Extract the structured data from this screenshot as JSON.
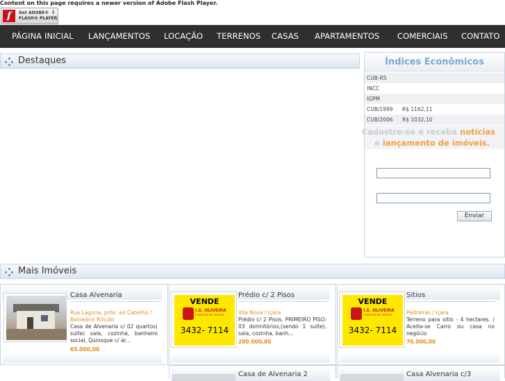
{
  "flash": {
    "message": "Content on this page requires a newer version of Adobe Flash Player.",
    "badge_line1": "Get ADOBE®",
    "badge_line2": "FLASH® PLAYER"
  },
  "nav": {
    "items": [
      "PÁGINA INICIAL",
      "LANÇAMENTOS",
      "LOCAÇÃO",
      "TERRENOS",
      "CASAS",
      "APARTAMENTOS",
      "COMERCIAIS",
      "CONTATO"
    ]
  },
  "destaques": {
    "title": "Destaques"
  },
  "indices": {
    "title": "Índices Econômicos",
    "rows": [
      {
        "label": "CUB-RS",
        "value": ""
      },
      {
        "label": "INCC",
        "value": ""
      },
      {
        "label": "IGPM",
        "value": ""
      },
      {
        "label": "CUB/1999",
        "value": "R$ 1162,11"
      },
      {
        "label": "CUB/2006",
        "value": "R$ 1032,10"
      }
    ]
  },
  "cadastro": {
    "line1_a": "Cadastre-se e receba ",
    "line1_b": "notícias",
    "line2_a": "e ",
    "line2_b": "lançamento de imóveis.",
    "name_value": "",
    "email_value": "",
    "submit_label": "Enviar"
  },
  "mais": {
    "title": "Mais Imóveis"
  },
  "listings": [
    {
      "title": "Casa Alvenaria",
      "location": "Rua Laguna, próx. ao Cabinho / Balneário Rincão",
      "description": "Casa de Alvenaria c/ 02 quartos( suite) sala, cozinha, banheiro social, Quiosque c/ ár...",
      "price": "65.000,00",
      "image": "house-photo"
    },
    {
      "title": "Prédio c/ 2 Pisos",
      "location": "Vila Nova / Içara",
      "description": "Prédio c/ 2 Pisos. PRIMEIRO PISO: 03 dormitórios,(sendo 1 suite), sala, cozinha, banh...",
      "price": "200.000,00",
      "image": "vende-sign"
    },
    {
      "title": "Sitios",
      "location": "Pedreiras / Içara",
      "description": "Terreno para sitio - 4 hectares. / Aceita-se Carro ou casa no negócio",
      "price": "70.000,00",
      "image": "vende-sign"
    }
  ],
  "vende_sign": {
    "word": "VENDE",
    "company": "I.S. OLIVEIRA",
    "tagline": "CORRETOR DE IMÓVEIS",
    "phone": "3432- 7114"
  },
  "listings_row2": [
    {
      "title": "Casa de Alvenaria 2"
    },
    {
      "title": "Casa Alvenaria c/3"
    }
  ]
}
